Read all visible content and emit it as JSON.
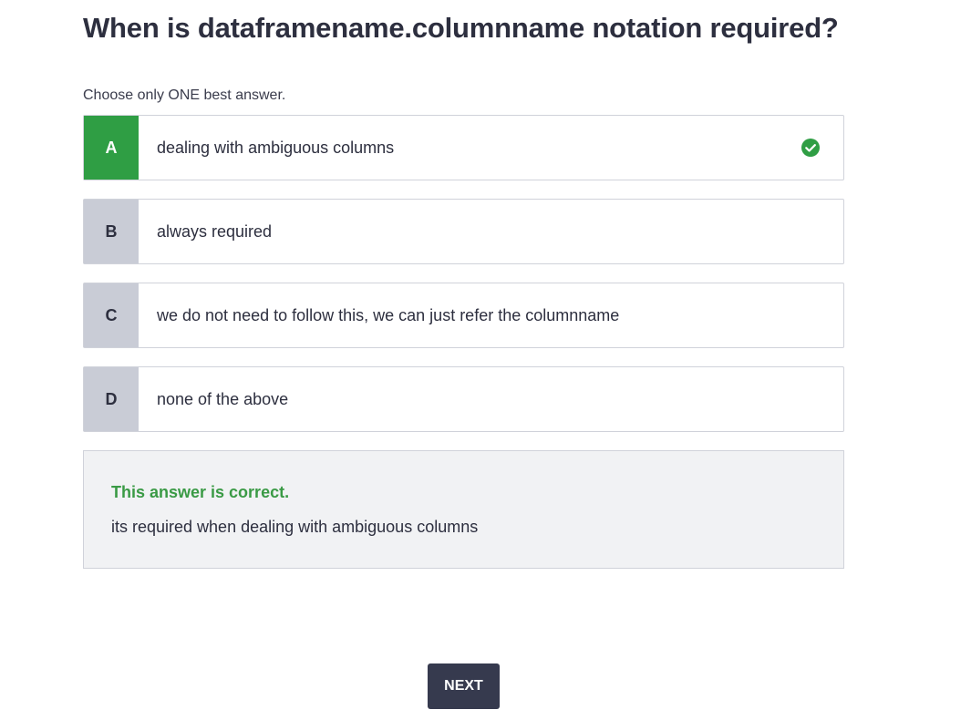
{
  "question": {
    "title": "When is dataframename.columnname notation required?",
    "instructions": "Choose only ONE best answer."
  },
  "options": [
    {
      "letter": "A",
      "text": "dealing with ambiguous columns",
      "state": "correct-selected"
    },
    {
      "letter": "B",
      "text": "always required",
      "state": "unselected"
    },
    {
      "letter": "C",
      "text": "we do not need to follow this, we can just refer the columnname",
      "state": "unselected"
    },
    {
      "letter": "D",
      "text": "none of the above",
      "state": "unselected"
    }
  ],
  "feedback": {
    "title": "This answer is correct.",
    "body": "its required when dealing with ambiguous columns"
  },
  "next_button": {
    "label": "NEXT"
  },
  "colors": {
    "correct_green": "#2f9e44",
    "letter_gray": "#c9ccd6",
    "text_dark": "#2d2f3f",
    "button_dark": "#363a4e",
    "feedback_bg": "#f1f2f4"
  },
  "icons": {
    "correct_indicator": "check-circle-icon"
  }
}
